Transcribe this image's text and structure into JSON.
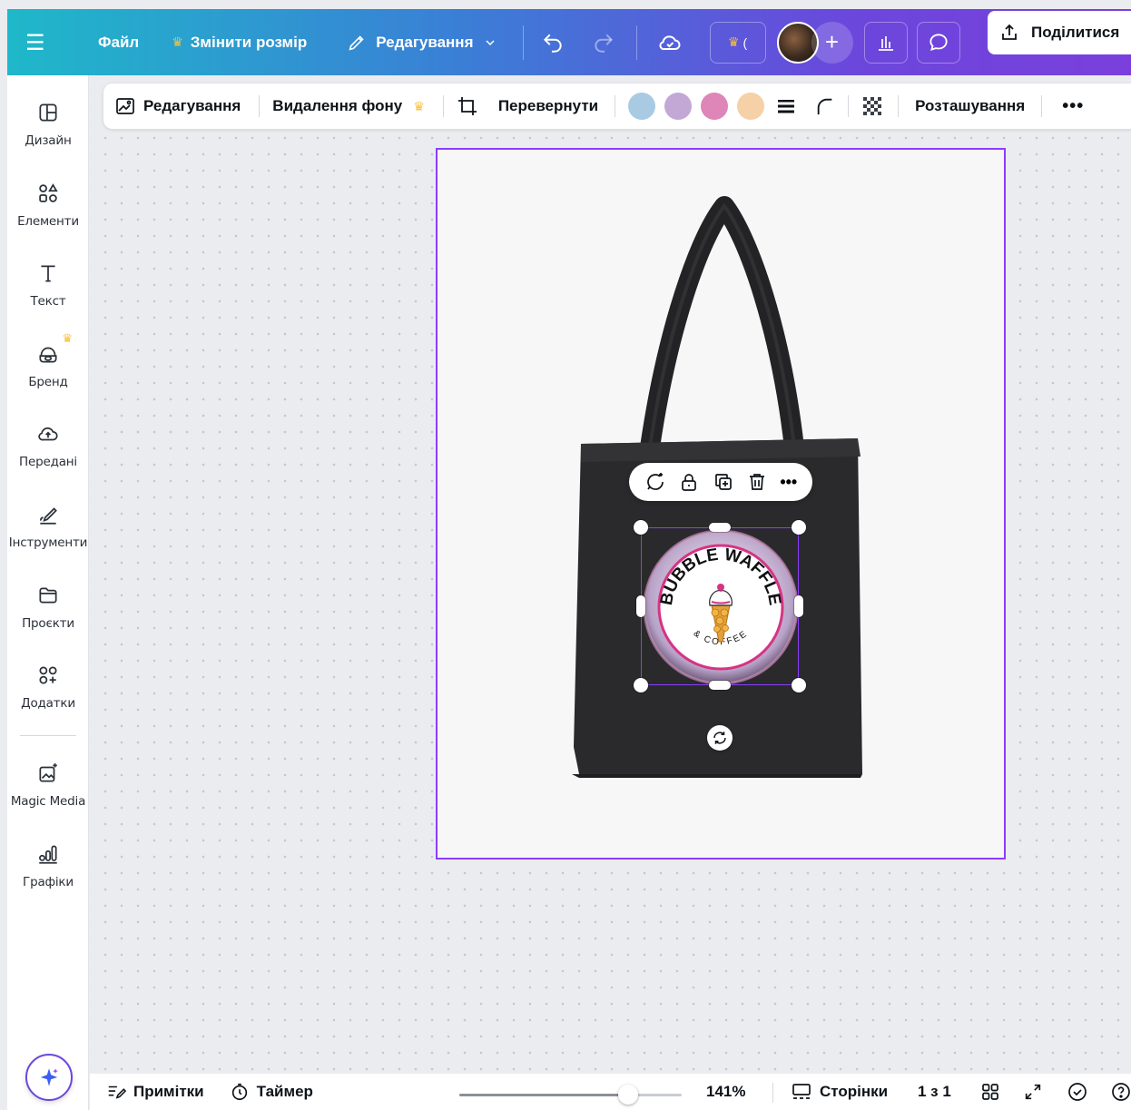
{
  "topbar": {
    "file_label": "Файл",
    "resize_label": "Змінити розмір",
    "edit_menu_label": "Редагування",
    "share_label": "Поділитися"
  },
  "sidebar": {
    "items": [
      {
        "label": "Дизайн",
        "icon": "layout-icon"
      },
      {
        "label": "Елементи",
        "icon": "shapes-icon"
      },
      {
        "label": "Текст",
        "icon": "text-icon"
      },
      {
        "label": "Бренд",
        "icon": "brand-icon"
      },
      {
        "label": "Передані",
        "icon": "cloud-upload-icon"
      },
      {
        "label": "Інструменти",
        "icon": "pen-icon"
      },
      {
        "label": "Проєкти",
        "icon": "folder-icon"
      },
      {
        "label": "Додатки",
        "icon": "apps-icon"
      },
      {
        "label": "Magic Media",
        "icon": "magic-media-icon"
      },
      {
        "label": "Графіки",
        "icon": "charts-icon"
      }
    ]
  },
  "context_toolbar": {
    "edit_label": "Редагування",
    "remove_bg_label": "Видалення фону",
    "flip_label": "Перевернути",
    "position_label": "Розташування",
    "swatches": [
      "#a8cbe3",
      "#c3a8d6",
      "#dd86b7",
      "#f6d0a7"
    ]
  },
  "logo": {
    "title": "BUBBLE WAFFLE",
    "subtitle": "& COFFEE"
  },
  "bottombar": {
    "notes_label": "Примітки",
    "timer_label": "Таймер",
    "zoom_value": "141%",
    "zoom_fraction": 0.76,
    "pages_label": "Сторінки",
    "page_count": "1 з 1"
  },
  "colors": {
    "accent": "#8b3dff",
    "crown": "#f7c23a",
    "bag": "#2a2a2c"
  }
}
